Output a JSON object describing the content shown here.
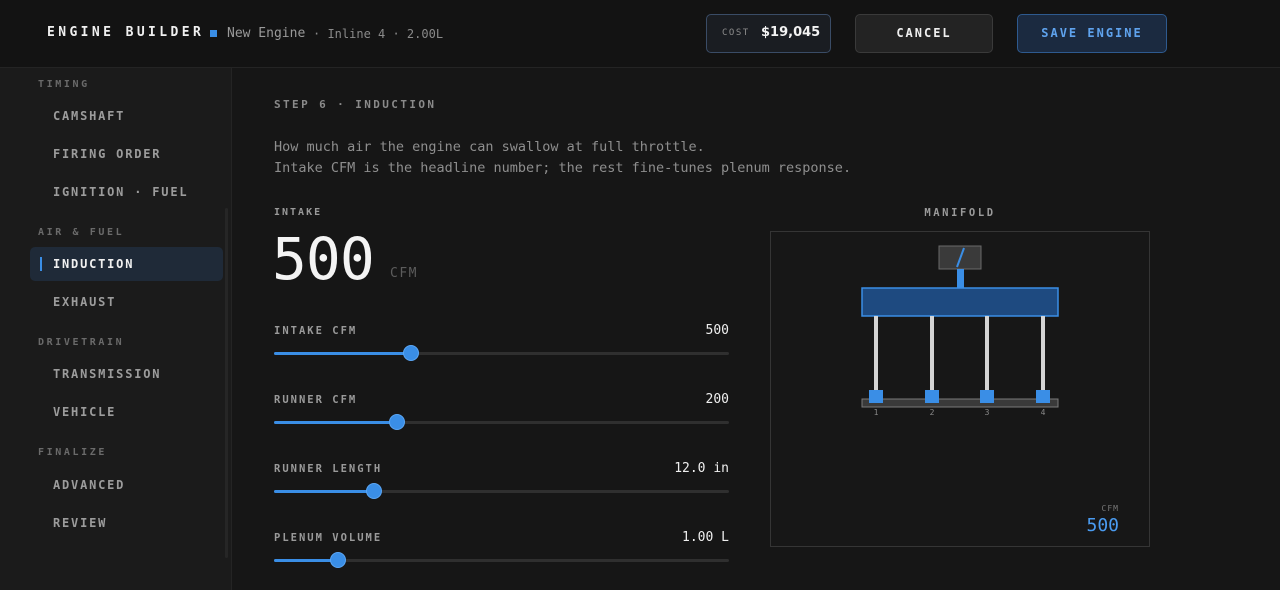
{
  "header": {
    "brand": "ENGINE BUILDER",
    "engine_name": "New Engine",
    "engine_spec": "· Inline 4 · 2.00L",
    "cost_label": "COST",
    "cost_value": "$19,045",
    "cancel_label": "CANCEL",
    "save_label": "SAVE ENGINE"
  },
  "sidebar": {
    "groups": [
      {
        "label": "TIMING",
        "items": [
          "CAMSHAFT",
          "FIRING ORDER",
          "IGNITION · FUEL"
        ]
      },
      {
        "label": "AIR & FUEL",
        "items": [
          "INDUCTION",
          "EXHAUST"
        ]
      },
      {
        "label": "DRIVETRAIN",
        "items": [
          "TRANSMISSION",
          "VEHICLE"
        ]
      },
      {
        "label": "FINALIZE",
        "items": [
          "ADVANCED",
          "REVIEW"
        ]
      }
    ],
    "active_item": "INDUCTION"
  },
  "main": {
    "step_label": "STEP 6 · INDUCTION",
    "description": [
      "How much air the engine can swallow at full throttle.",
      "Intake CFM is the headline number; the rest fine-tunes plenum response."
    ],
    "intake_label": "INTAKE",
    "intake_value": "500",
    "intake_unit": "CFM",
    "params": [
      {
        "name": "INTAKE CFM",
        "value": "500",
        "level": 0.3
      },
      {
        "name": "RUNNER CFM",
        "value": "200",
        "level": 0.27
      },
      {
        "name": "RUNNER LENGTH",
        "value": "12.0 in",
        "level": 0.22
      },
      {
        "name": "PLENUM VOLUME",
        "value": "1.00 L",
        "level": 0.14
      }
    ]
  },
  "manifold": {
    "title": "MANIFOLD",
    "cylinder_labels": [
      "1",
      "2",
      "3",
      "4"
    ],
    "cfm_label": "CFM",
    "cfm_value": "500",
    "accent_color": "#3a8ee6"
  }
}
